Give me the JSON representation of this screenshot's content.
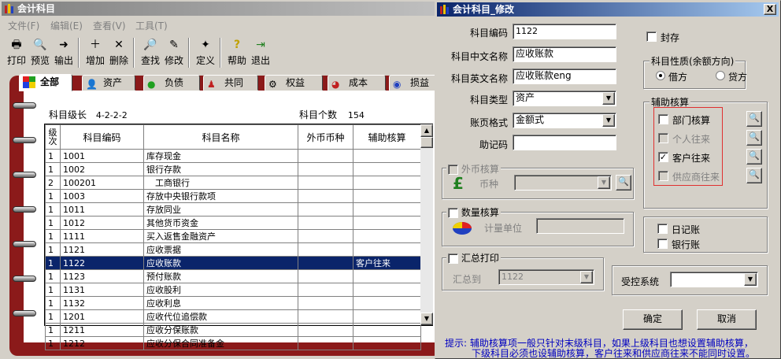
{
  "main": {
    "title": "会计科目",
    "menu": [
      "文件(F)",
      "编辑(E)",
      "查看(V)",
      "工具(T)"
    ],
    "toolbar": [
      "打印",
      "预览",
      "输出",
      "增加",
      "删除",
      "查找",
      "修改",
      "定义",
      "帮助",
      "退出"
    ],
    "tabs": [
      "全部",
      "资产",
      "负债",
      "共同",
      "权益",
      "成本",
      "损益"
    ],
    "level_label": "科目级长",
    "level_value": "4-2-2-2",
    "count_label": "科目个数",
    "count_value": "154",
    "columns": [
      "级次",
      "科目编码",
      "科目名称",
      "外币币种",
      "辅助核算"
    ],
    "rows": [
      [
        "1",
        "1001",
        "库存现金",
        "",
        ""
      ],
      [
        "1",
        "1002",
        "银行存款",
        "",
        ""
      ],
      [
        "2",
        "100201",
        "　工商银行",
        "",
        ""
      ],
      [
        "1",
        "1003",
        "存放中央银行款项",
        "",
        ""
      ],
      [
        "1",
        "1011",
        "存放同业",
        "",
        ""
      ],
      [
        "1",
        "1012",
        "其他货币资金",
        "",
        ""
      ],
      [
        "1",
        "1111",
        "买入返售金融资产",
        "",
        ""
      ],
      [
        "1",
        "1121",
        "应收票据",
        "",
        ""
      ],
      [
        "1",
        "1122",
        "应收账款",
        "",
        "客户往来"
      ],
      [
        "1",
        "1123",
        "预付账款",
        "",
        ""
      ],
      [
        "1",
        "1131",
        "应收股利",
        "",
        ""
      ],
      [
        "1",
        "1132",
        "应收利息",
        "",
        ""
      ],
      [
        "1",
        "1201",
        "应收代位追偿款",
        "",
        ""
      ],
      [
        "1",
        "1211",
        "应收分保账款",
        "",
        ""
      ],
      [
        "1",
        "1212",
        "应收分保合同准备金",
        "",
        ""
      ]
    ],
    "selected_row": 8
  },
  "dialog": {
    "title": "会计科目_修改",
    "code_label": "科目编码",
    "code_value": "1122",
    "cn_label": "科目中文名称",
    "cn_value": "应收账款",
    "en_label": "科目英文名称",
    "en_value": "应收账款eng",
    "type_label": "科目类型",
    "type_value": "资产",
    "format_label": "账页格式",
    "format_value": "金额式",
    "memo_label": "助记码",
    "memo_value": "",
    "seal_label": "封存",
    "nature_title": "科目性质(余额方向)",
    "debit_label": "借方",
    "credit_label": "贷方",
    "nature_selected": "借方",
    "aux_title": "辅助核算",
    "aux_items": [
      {
        "label": "部门核算",
        "checked": false,
        "enabled": true
      },
      {
        "label": "个人往来",
        "checked": false,
        "enabled": false
      },
      {
        "label": "客户往来",
        "checked": true,
        "enabled": true
      },
      {
        "label": "供应商往来",
        "checked": false,
        "enabled": false
      }
    ],
    "fx_title": "外币核算",
    "fx_currency_label": "币种",
    "qty_title": "数量核算",
    "qty_unit_label": "计量单位",
    "summary_title": "汇总打印",
    "summary_to_label": "汇总到",
    "summary_to_value": "1122",
    "journal_label": "日记账",
    "bank_label": "银行账",
    "controlled_label": "受控系统",
    "controlled_value": "",
    "ok_label": "确定",
    "cancel_label": "取消",
    "hint_line1": "提示: 辅助核算项一般只针对末级科目，如果上级科目也想设置辅助核算，",
    "hint_line2": "下级科目必须也设辅助核算，客户往来和供应商往来不能同时设置。",
    "close_label": "X"
  },
  "colors": {
    "title_active": "#0a246a",
    "binder": "#8b1a1a",
    "aux_border": "#e03030",
    "hint_text": "#0000c0"
  }
}
